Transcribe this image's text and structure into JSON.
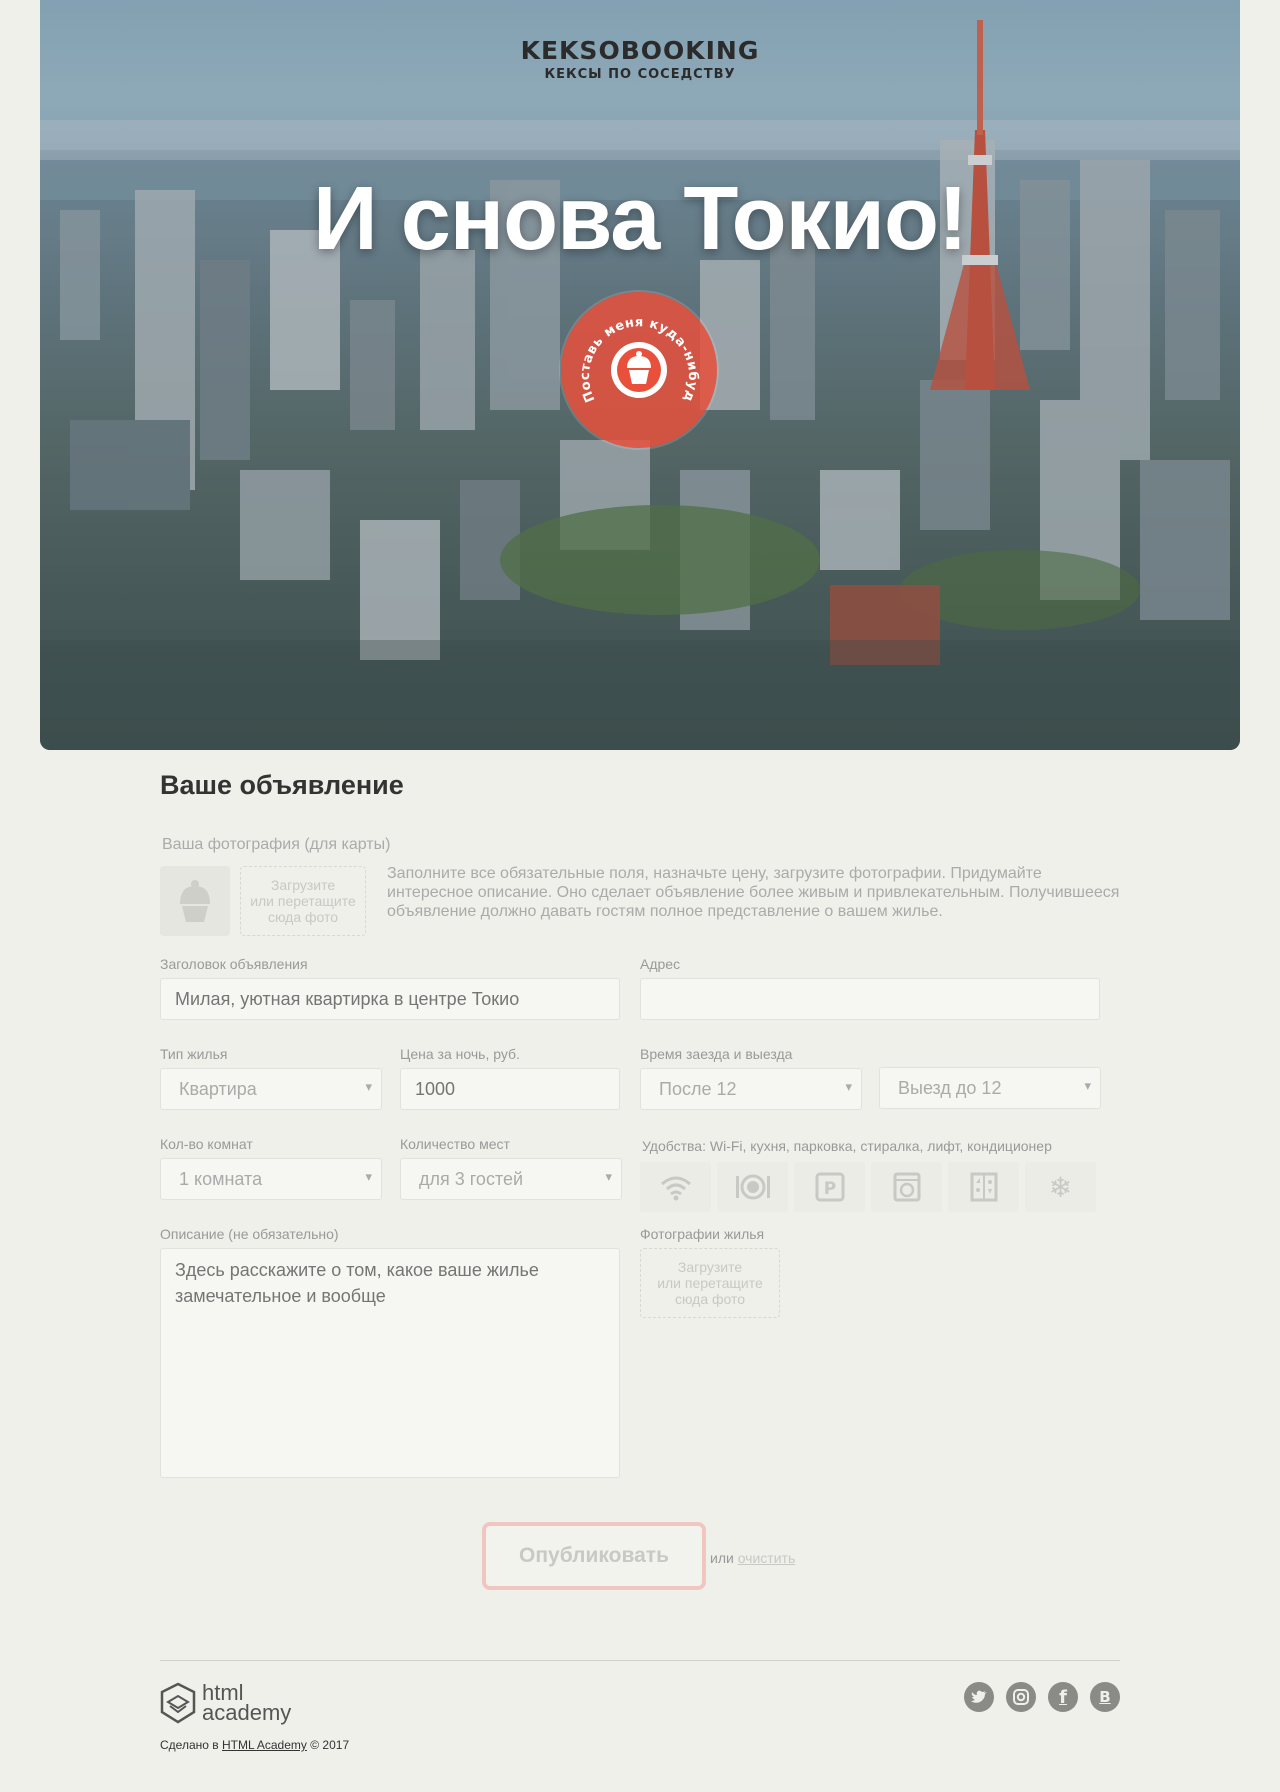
{
  "header": {
    "logo_name": "KEKSOBOOKING",
    "logo_sub": "КЕКСЫ ПО СОСЕДСТВУ",
    "hero_title": "И снова Токио!",
    "main_pin_text": "Поставь меня куда-нибудь"
  },
  "form": {
    "title": "Ваше объявление",
    "avatar_label": "Ваша фотография (для карты)",
    "avatar_drop": [
      "Загрузите",
      "или перетащите",
      "сюда фото"
    ],
    "hint": "Заполните все обязательные поля, назначьте цену, загрузите фотографии. Придумайте интересное описание. Оно сделает объявление более живым и привлекательным. Получившееся объявление должно давать гостям полное представление о вашем жилье.",
    "title_field": {
      "label": "Заголовок объявления",
      "placeholder": "Милая, уютная квартирка в центре Токио"
    },
    "address_field": {
      "label": "Адрес",
      "value": ""
    },
    "type_field": {
      "label": "Тип жилья",
      "value": "Квартира"
    },
    "price_field": {
      "label": "Цена за ночь, руб.",
      "placeholder": "1000"
    },
    "time_field": {
      "label": "Время заезда и выезда",
      "checkin": "После 12",
      "checkout": "Выезд до 12"
    },
    "rooms_field": {
      "label": "Кол-во комнат",
      "value": "1 комната"
    },
    "capacity_field": {
      "label": "Количество мест",
      "value": "для 3 гостей"
    },
    "features": {
      "label": "Удобства: Wi-Fi, кухня, парковка, стиралка, лифт, кондиционер",
      "items": [
        "wifi-icon",
        "dishwasher-icon",
        "parking-icon",
        "washer-icon",
        "elevator-icon",
        "conditioner-icon"
      ]
    },
    "description_field": {
      "label": "Описание (не обязательно)",
      "placeholder": "Здесь расскажите о том, какое ваше жилье замечательное и вообще"
    },
    "photos_field": {
      "label": "Фотографии жилья",
      "drop": [
        "Загрузите",
        "или перетащите",
        "сюда фото"
      ]
    },
    "submit_label": "Опубликовать",
    "or_text": "или",
    "reset_label": "очистить"
  },
  "footer": {
    "brand_line1": "html",
    "brand_line2": "academy",
    "made_in": "Сделано в",
    "academy_link": "HTML Academy",
    "year": "© 2017",
    "socials": [
      "twitter-icon",
      "instagram-icon",
      "facebook-icon",
      "vk-icon"
    ],
    "vk_letter": "B"
  },
  "colors": {
    "background": "#f0f0ea",
    "accent": "#e8503c",
    "submit_border": "#f2c6c0"
  }
}
